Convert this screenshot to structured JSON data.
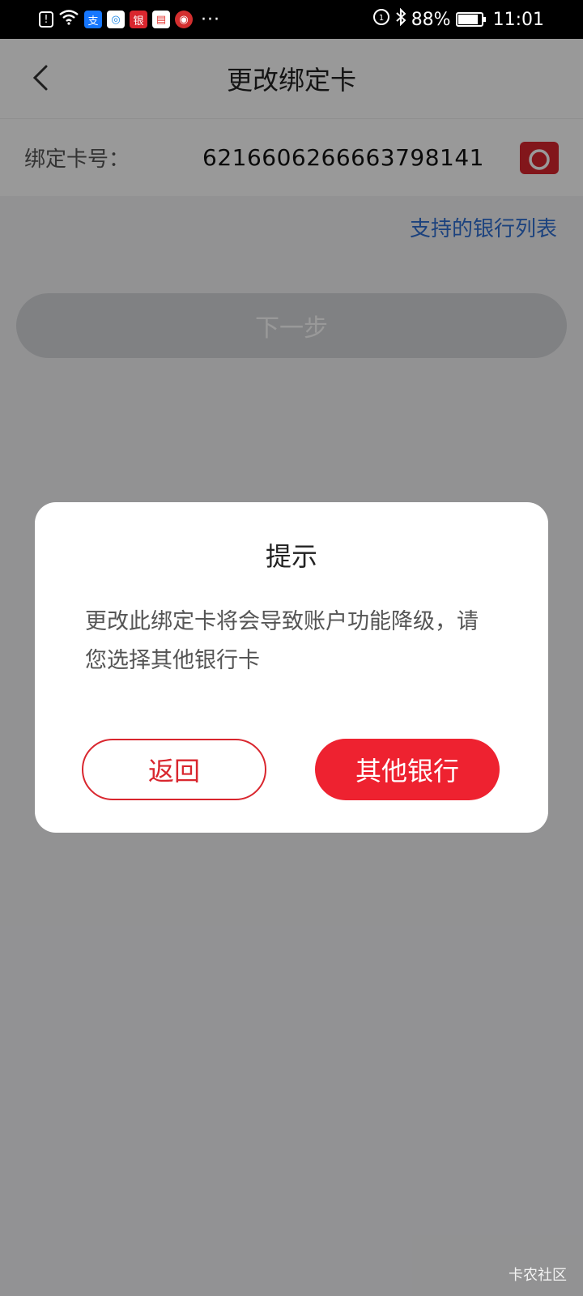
{
  "status_bar": {
    "alert_icon": "!",
    "app_icons": [
      {
        "name": "alipay-icon",
        "glyph": "支",
        "color": "#1677ff"
      },
      {
        "name": "browser-icon",
        "glyph": "◎",
        "color": "#1e88e5"
      },
      {
        "name": "bank-app-icon-1",
        "glyph": "银",
        "color": "#d9262e"
      },
      {
        "name": "bank-app-icon-2",
        "glyph": "▤",
        "color": "#e53935"
      },
      {
        "name": "bank-app-icon-3",
        "glyph": "◉",
        "color": "#d32f2f"
      }
    ],
    "more": "···",
    "battery": "88%",
    "time": "11:01"
  },
  "header": {
    "back": "‹",
    "title": "更改绑定卡"
  },
  "card": {
    "label": "绑定卡号：",
    "number": "6216606266663798141",
    "camera_icon": "camera-icon"
  },
  "links": {
    "bank_list": "支持的银行列表"
  },
  "next_button": {
    "label": "下一步"
  },
  "dialog": {
    "title": "提示",
    "message": "更改此绑定卡将会导致账户功能降级，请您选择其他银行卡",
    "return_label": "返回",
    "other_label": "其他银行"
  },
  "watermark": "卡农社区",
  "colors": {
    "accent_red": "#ee2230",
    "link_blue": "#2f6fd3"
  }
}
